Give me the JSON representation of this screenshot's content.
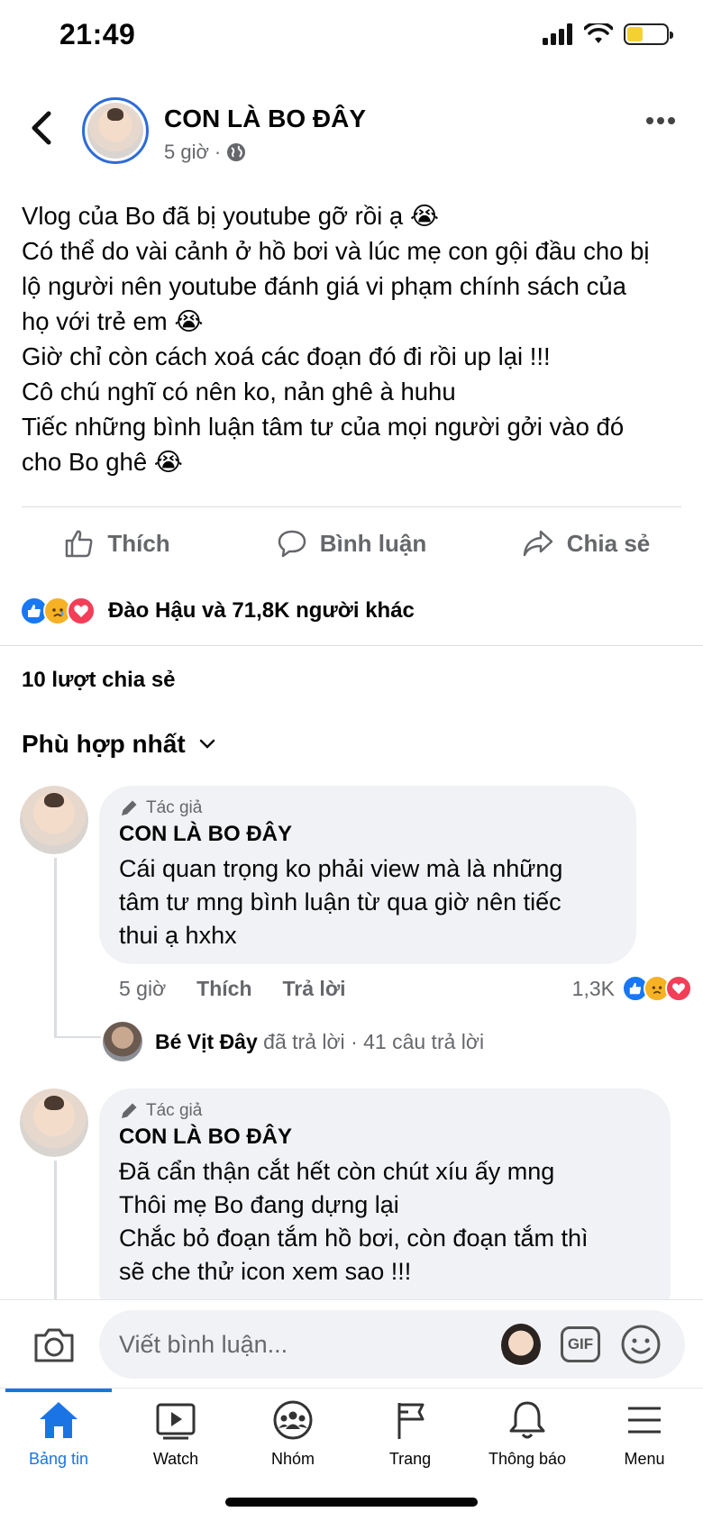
{
  "status_bar": {
    "time": "21:49"
  },
  "post": {
    "author": "CON LÀ BO ĐÂY",
    "time": "5 giờ",
    "separator": "·",
    "lines": [
      "Vlog của Bo đã bị youtube gỡ rồi ạ 😭",
      "Có thể do vài cảnh ở hồ bơi và lúc mẹ con gội đầu cho bị",
      "lộ người nên youtube đánh giá vi phạm chính sách của",
      "họ với trẻ em 😭",
      "Giờ chỉ còn cách xoá các đoạn đó đi rồi up lại !!!",
      "Cô chú nghĩ có nên ko, nản ghê à huhu",
      "Tiếc những bình luận tâm tư của mọi người gởi vào đó",
      "cho Bo ghê 😭"
    ]
  },
  "actions": {
    "like": "Thích",
    "comment": "Bình luận",
    "share": "Chia sẻ"
  },
  "reactions": {
    "text": "Đào Hậu và 71,8K người khác",
    "like_color": "#1877f2",
    "love_color": "#f33e58",
    "sad_color": "#f7b125"
  },
  "shares": "10 lượt chia sẻ",
  "sort": "Phù hợp nhất",
  "comments": [
    {
      "tag": "Tác giả",
      "name": "CON LÀ BO ĐÂY",
      "lines": [
        "Cái quan trọng ko phải view mà là những",
        "tâm tư mng bình luận từ qua giờ nên tiếc",
        "thui ạ hxhx"
      ],
      "time": "5 giờ",
      "like": "Thích",
      "reply": "Trả lời",
      "reaction_count": "1,3K",
      "reply_preview": {
        "name": "Bé Vịt Đây",
        "text": "đã trả lời",
        "count": "· 41 câu trả lời"
      }
    },
    {
      "tag": "Tác giả",
      "name": "CON LÀ BO ĐÂY",
      "lines": [
        "Đã cẩn thận cắt hết còn chút xíu ấy mng",
        "Thôi mẹ Bo đang dựng lại",
        "Chắc bỏ đoạn tắm hồ bơi, còn đoạn tắm thì",
        "sẽ che thử icon xem sao !!!"
      ]
    }
  ],
  "composer": {
    "placeholder": "Viết bình luận...",
    "gif": "GIF"
  },
  "tabs": [
    {
      "label": "Bảng tin",
      "icon": "home-icon"
    },
    {
      "label": "Watch",
      "icon": "watch-icon"
    },
    {
      "label": "Nhóm",
      "icon": "groups-icon"
    },
    {
      "label": "Trang",
      "icon": "pages-flag-icon"
    },
    {
      "label": "Thông báo",
      "icon": "bell-icon"
    },
    {
      "label": "Menu",
      "icon": "menu-icon"
    }
  ]
}
